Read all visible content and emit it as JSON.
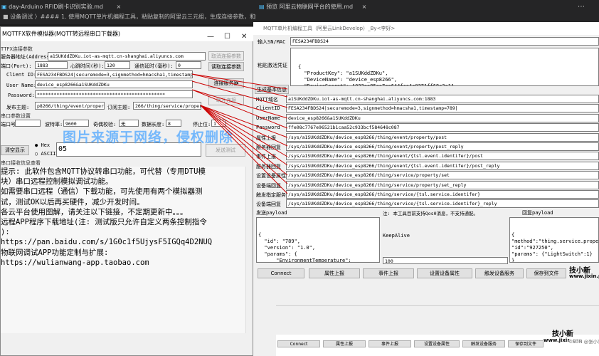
{
  "topbar": {
    "tab1": "day-Arduino RFID刷卡识别实验.md",
    "tab2": "预览 阿里云物联网平台的使用.md",
    "breadcrumb": "■ 设备调试 〉#### 1. 使用MQTT单片机编程工具，粘贴复制的阿里云三元组，生成连接参数，和报文格式信息"
  },
  "left": {
    "title": "MQTTFX软件模拟器(MQTT转远程串口下载器)",
    "section_conn": "TTFX连接参数",
    "server_label": "服务器地址(Address):",
    "server_value": "a1SUKddZDKu.iot-as-mqtt.cn-shanghai.aliyuncs.com",
    "port_label": "端口(Port):",
    "port_value": "1883",
    "heartbeat_label": "心跳时间(秒):",
    "heartbeat_value": "120",
    "timeout_label": "通信延时(毫秒):",
    "timeout_value": "0",
    "clientid_label": "Client ID:",
    "clientid_value": "FESA234FBDS24|securemode=3,signmethod=hmacsha1,timestamp=789|",
    "username_label": "User Name:",
    "username_value": "device_esp8266&a1SUKddZDKu",
    "password_label": "Password:",
    "password_value": "**********************************************",
    "btn_cancel_conn": "取消连接参数",
    "btn_read_conn": "读取连接参数",
    "btn_connect_server": "连接服务器",
    "btn_disconnect": "断开连接",
    "pub_label": "发布主题:",
    "pub_value": "p8266/thing/event/property/post",
    "sub_label": "订阅主题:",
    "sub_value": "266/thing/service/property/set",
    "section_serial": "串口参数设置",
    "com_label": "端口号:",
    "baud_label": "波特率:",
    "baud_value": "9600",
    "parity_label": "奇偶校验:",
    "parity_value": "无",
    "databits_label": "数据长度:",
    "databits_value": "8",
    "stopbits_label": "停止位:",
    "stopbits_value": "1",
    "btn_clear": "清空显示",
    "radio_hex": "Hex",
    "radio_ascii": "ASCII",
    "send_value": "05",
    "btn_send": "发送测试",
    "section_recv": "串口接收信息查看",
    "recv_lines": [
      "提示: 此软件包含MQTT协议转串口功能，可代替（专用DTU模",
      "块）串口远程控制模拟调试功能。",
      "如需要串口远程（通信）下载功能，可先使用有两个模拟器测",
      "试，测试OK以后再买硬件，减少开发时间。",
      "",
      "各云平台使用图解，请关注以下链接，不定期更新中。。。",
      "远程APP程序下载地址(注: 测试版只允许自定义两条控制指令",
      "):",
      "https://pan.baidu.com/s/1G0c1f5UjysF5IGQq4D2NUQ",
      "",
      "物联网调试APP功能定制与扩展:",
      "https://wulianwang-app.taobao.com"
    ]
  },
  "watermark": "图片来源于网络，侵权删除",
  "right": {
    "title": "MQTT单片机编程工具（阿里云LinkDevelop）_By<李好>",
    "sn_label": "输入SN/MAC",
    "sn_value": "FESA234FBDS24",
    "paste_label": "粘贴激活凭证",
    "credential_lines": [
      "{",
      "  \"ProductKey\": \"a1SUKddZDKu\",",
      "  \"DeviceName\": \"device_esp8266\",",
      "  \"DeviceSecret\": \"022ae85aa7ee644fca4c0271ff68e3a1\""
    ],
    "btn_generate": "生成基本信息",
    "fields": [
      {
        "label": "MQTT域名",
        "value": "a1SUKddZDKu.iot-as-mqtt.cn-shanghai.aliyuncs.com:1883"
      },
      {
        "label": "ClientID",
        "value": "FESA234FBDS24|securemode=3,signmethod=hmacsha1,timestamp=789|"
      },
      {
        "label": "UserName",
        "value": "device_esp8266&a1SUKddZDKu"
      },
      {
        "label": "Password",
        "value": "ffe08c7767e96521b1caa52c933bcf584648c087"
      },
      {
        "label": "属性上报",
        "value": "/sys/a1SUKddZDKu/device_esp8266/thing/event/property/post"
      },
      {
        "label": "服务器回复",
        "value": "/sys/a1SUKddZDKu/device_esp8266/thing/event/property/post_reply"
      },
      {
        "label": "事件上报",
        "value": "/sys/a1SUKddZDKu/device_esp8266/thing/event/{tsl.event.identifer}/post"
      },
      {
        "label": "服务器回复",
        "value": "/sys/a1SUKddZDKu/device_esp8266/thing/event/{tsl.event.identifer}/post_reply"
      },
      {
        "label": "设置设备属性",
        "value": "/sys/a1SUKddZDKu/device_esp8266/thing/service/property/set"
      },
      {
        "label": "设备端回复",
        "value": "/sys/a1SUKddZDKu/device_esp8266/thing/service/property/set_reply"
      },
      {
        "label": "触发指定服务",
        "value": "/sys/a1SUKddZDKu/device_esp8266/thing/service/{tsl.service.identifer}"
      },
      {
        "label": "设备端回复",
        "value": "/sys/a1SUKddZDKu/device_esp8266/thing/service/{tsl.service.identifer}_reply"
      }
    ],
    "send_payload_label": "发送payload",
    "note": "注: 本工具目前支持Qos0消息，不支持通配。",
    "reply_payload_label": "回复payload",
    "send_payload_lines": [
      "{",
      "  \"id\": \"789\",",
      "  \"version\": \"1.0\",",
      "  \"params\": {",
      "      \"EnvironmentTemperature\":",
      "+15.5,",
      "      \"EnvironmentHumidity\":63.4 ,",
      "      \"BatteryPercentage\":42,"
    ],
    "keepalive_label": "KeepAlive",
    "keepalive_value": "100",
    "reply_payload_lines": [
      "{",
      "\"method\":\"thing.service.proper",
      "\"id\":\"927250\",",
      "\"params\": {\"LightSwitch\":1}",
      "}"
    ],
    "buttons": [
      "Connect",
      "属性上报",
      "事件上报",
      "设置设备属性",
      "触发设备服务",
      "保存到文件"
    ],
    "logo_cn": "技小新",
    "logo_url": "www.jixin.pro",
    "bottom_buttons": [
      "Connect",
      "属性上报",
      "事件上报",
      "设置设备属性",
      "触发设备服务",
      "保存到文件"
    ],
    "bottom_logo_cn": "技小新",
    "bottom_logo_url": "www.jixin.pro",
    "csdn_mark": "CSDN @张小羽ovo"
  }
}
